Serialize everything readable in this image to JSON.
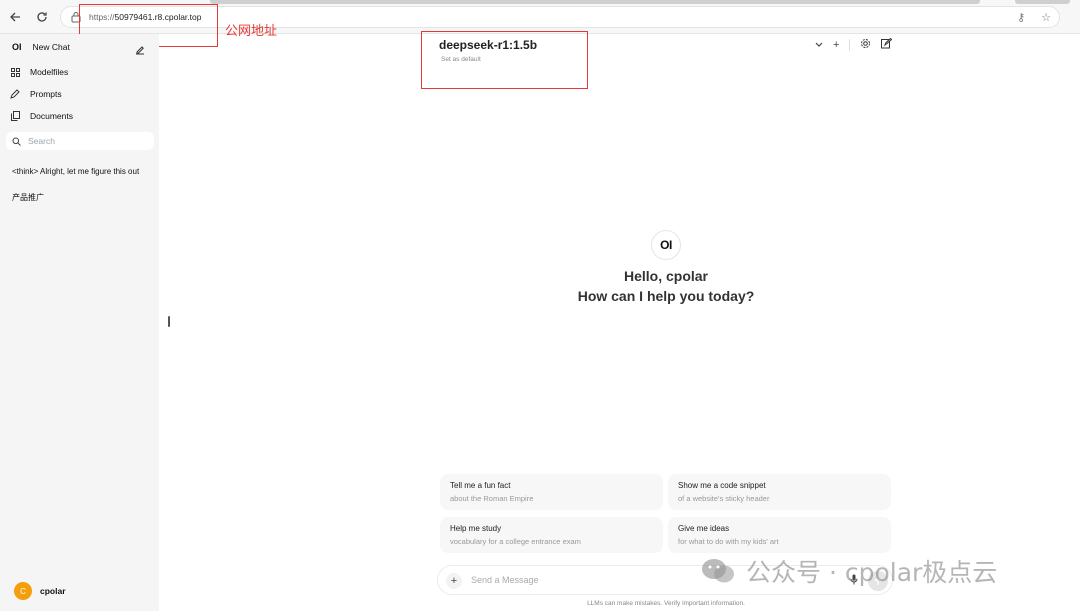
{
  "browser": {
    "url_scheme": "https://",
    "url_host": "50979461.r8.cpolar.top",
    "back_icon": "arrow-left-icon",
    "reload_icon": "reload-icon",
    "lock_icon": "lock-icon"
  },
  "annotations": {
    "url_label": "公网地址"
  },
  "sidebar": {
    "logo_text": "OI",
    "new_chat": "New Chat",
    "items": [
      {
        "label": "Modelfiles",
        "icon": "grid-icon"
      },
      {
        "label": "Prompts",
        "icon": "pencil-icon"
      },
      {
        "label": "Documents",
        "icon": "documents-icon"
      }
    ],
    "search_placeholder": "Search",
    "chats": [
      "<think> Alright, let me figure this out",
      "产品推广"
    ],
    "user": {
      "avatar_letter": "C",
      "name": "cpolar"
    }
  },
  "header": {
    "model_name": "deepseek-r1:1.5b",
    "set_default": "Set as default",
    "plus": "+"
  },
  "main": {
    "logo_text": "OI",
    "greeting": "Hello, cpolar",
    "prompt": "How can I help you today?"
  },
  "suggestions": [
    {
      "title": "Tell me a fun fact",
      "subtitle": "about the Roman Empire"
    },
    {
      "title": "Show me a code snippet",
      "subtitle": "of a website's sticky header"
    },
    {
      "title": "Help me study",
      "subtitle": "vocabulary for a college entrance exam"
    },
    {
      "title": "Give me ideas",
      "subtitle": "for what to do with my kids' art"
    }
  ],
  "composer": {
    "placeholder": "Send a Message",
    "disclaimer": "LLMs can make mistakes. Verify important information."
  },
  "watermark": {
    "text": "公众号 · cpolar极点云"
  },
  "colors": {
    "annotation": "#e53935",
    "avatar": "#f59e0b",
    "sidebar_bg": "#f5f5f5"
  }
}
